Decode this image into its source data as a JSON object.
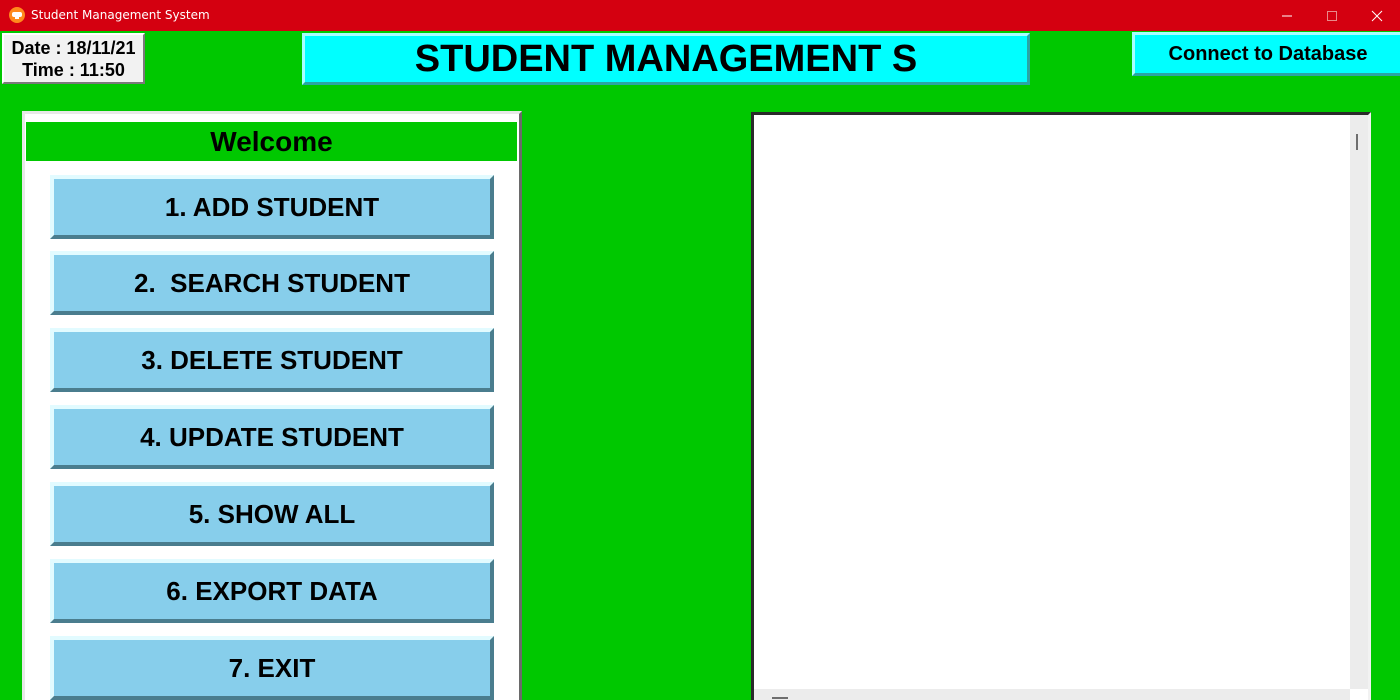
{
  "window": {
    "title": "Student Management System"
  },
  "header": {
    "date": "Date : 18/11/21",
    "time": "Time : 11:50",
    "heading": "STUDENT MANAGEMENT S",
    "connect_label": "Connect to Database"
  },
  "menu": {
    "welcome": "Welcome",
    "items": [
      {
        "label": "1. ADD STUDENT"
      },
      {
        "label": "2.  SEARCH STUDENT"
      },
      {
        "label": "3. DELETE STUDENT"
      },
      {
        "label": "4. UPDATE STUDENT"
      },
      {
        "label": "5. SHOW ALL"
      },
      {
        "label": "6. EXPORT DATA"
      },
      {
        "label": "7. EXIT"
      }
    ]
  },
  "colors": {
    "titlebar": "#d40010",
    "background": "#00c800",
    "heading_bg": "#00ffff",
    "menu_button": "#87ceeb",
    "panel": "#ffffff"
  },
  "icons": [
    "app-icon",
    "minimize-icon",
    "maximize-icon",
    "close-icon"
  ]
}
